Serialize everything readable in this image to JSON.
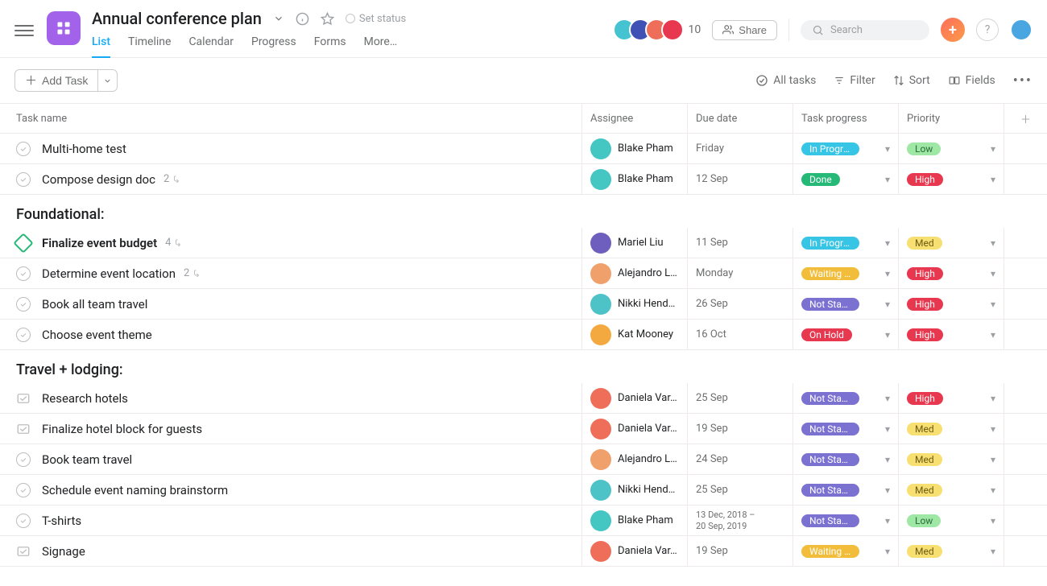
{
  "project": {
    "title": "Annual conference plan",
    "set_status": "Set status"
  },
  "tabs": [
    "List",
    "Timeline",
    "Calendar",
    "Progress",
    "Forms",
    "More…"
  ],
  "active_tab": 0,
  "top": {
    "member_overflow": "10",
    "share": "Share",
    "search_placeholder": "Search",
    "help": "?"
  },
  "toolbar": {
    "add_task": "Add Task",
    "all_tasks": "All tasks",
    "filter": "Filter",
    "sort": "Sort",
    "fields": "Fields"
  },
  "columns": {
    "name": "Task name",
    "assignee": "Assignee",
    "due": "Due date",
    "progress": "Task progress",
    "priority": "Priority"
  },
  "sections": [
    {
      "title": null,
      "tasks": [
        {
          "icon": "check",
          "name": "Multi-home test",
          "bold": false,
          "sub": null,
          "assignee": {
            "name": "Blake Pham",
            "cls": "avc-bp"
          },
          "due": "Friday",
          "progress": {
            "label": "In Progre…",
            "cls": "pg-inprog"
          },
          "priority": {
            "label": "Low",
            "cls": "pr-low"
          }
        },
        {
          "icon": "check",
          "name": "Compose design doc",
          "bold": false,
          "sub": "2",
          "assignee": {
            "name": "Blake Pham",
            "cls": "avc-bp"
          },
          "due": "12 Sep",
          "progress": {
            "label": "Done",
            "cls": "pg-done"
          },
          "priority": {
            "label": "High",
            "cls": "pr-high"
          }
        }
      ]
    },
    {
      "title": "Foundational:",
      "tasks": [
        {
          "icon": "milestone",
          "name": "Finalize event budget",
          "bold": true,
          "sub": "4",
          "assignee": {
            "name": "Mariel Liu",
            "cls": "avc-ml"
          },
          "due": "11 Sep",
          "progress": {
            "label": "In Progre…",
            "cls": "pg-inprog"
          },
          "priority": {
            "label": "Med",
            "cls": "pr-med"
          }
        },
        {
          "icon": "check",
          "name": "Determine event location",
          "bold": false,
          "sub": "2",
          "assignee": {
            "name": "Alejandro L…",
            "cls": "avc-al"
          },
          "due": "Monday",
          "progress": {
            "label": "Waiting o…",
            "cls": "pg-wait"
          },
          "priority": {
            "label": "High",
            "cls": "pr-high"
          }
        },
        {
          "icon": "check",
          "name": "Book all team travel",
          "bold": false,
          "sub": null,
          "assignee": {
            "name": "Nikki Hend…",
            "cls": "avc-nh"
          },
          "due": "26 Sep",
          "progress": {
            "label": "Not Start…",
            "cls": "pg-not"
          },
          "priority": {
            "label": "High",
            "cls": "pr-high"
          }
        },
        {
          "icon": "check",
          "name": "Choose event theme",
          "bold": false,
          "sub": null,
          "assignee": {
            "name": "Kat Mooney",
            "cls": "avc-km"
          },
          "due": "16 Oct",
          "progress": {
            "label": "On Hold",
            "cls": "pg-hold"
          },
          "priority": {
            "label": "High",
            "cls": "pr-high"
          }
        }
      ]
    },
    {
      "title": "Travel + lodging:",
      "tasks": [
        {
          "icon": "approval",
          "name": "Research hotels",
          "bold": false,
          "sub": null,
          "assignee": {
            "name": "Daniela Var…",
            "cls": "avc-dv"
          },
          "due": "25 Sep",
          "progress": {
            "label": "Not Start…",
            "cls": "pg-not"
          },
          "priority": {
            "label": "High",
            "cls": "pr-high"
          }
        },
        {
          "icon": "approval",
          "name": "Finalize hotel block for guests",
          "bold": false,
          "sub": null,
          "assignee": {
            "name": "Daniela Var…",
            "cls": "avc-dv"
          },
          "due": "19 Sep",
          "progress": {
            "label": "Not Start…",
            "cls": "pg-not"
          },
          "priority": {
            "label": "Med",
            "cls": "pr-med"
          }
        },
        {
          "icon": "check",
          "name": "Book team travel",
          "bold": false,
          "sub": null,
          "assignee": {
            "name": "Alejandro L…",
            "cls": "avc-al"
          },
          "due": "24 Sep",
          "progress": {
            "label": "Not Start…",
            "cls": "pg-not"
          },
          "priority": {
            "label": "Med",
            "cls": "pr-med"
          }
        },
        {
          "icon": "check",
          "name": "Schedule event naming brainstorm",
          "bold": false,
          "sub": null,
          "assignee": {
            "name": "Nikki Hend…",
            "cls": "avc-nh"
          },
          "due": "25 Sep",
          "progress": {
            "label": "Not Start…",
            "cls": "pg-not"
          },
          "priority": {
            "label": "Med",
            "cls": "pr-med"
          }
        },
        {
          "icon": "check",
          "name": "T-shirts",
          "bold": false,
          "sub": null,
          "assignee": {
            "name": "Blake Pham",
            "cls": "avc-bp"
          },
          "due_multi": [
            "13 Dec, 2018 –",
            "20 Sep, 2019"
          ],
          "progress": {
            "label": "Not Start…",
            "cls": "pg-not"
          },
          "priority": {
            "label": "Low",
            "cls": "pr-low"
          }
        },
        {
          "icon": "approval",
          "name": "Signage",
          "bold": false,
          "sub": null,
          "assignee": {
            "name": "Daniela Var…",
            "cls": "avc-dv"
          },
          "due": "19 Sep",
          "progress": {
            "label": "Waiting o…",
            "cls": "pg-wait"
          },
          "priority": {
            "label": "Med",
            "cls": "pr-med"
          }
        }
      ]
    }
  ]
}
